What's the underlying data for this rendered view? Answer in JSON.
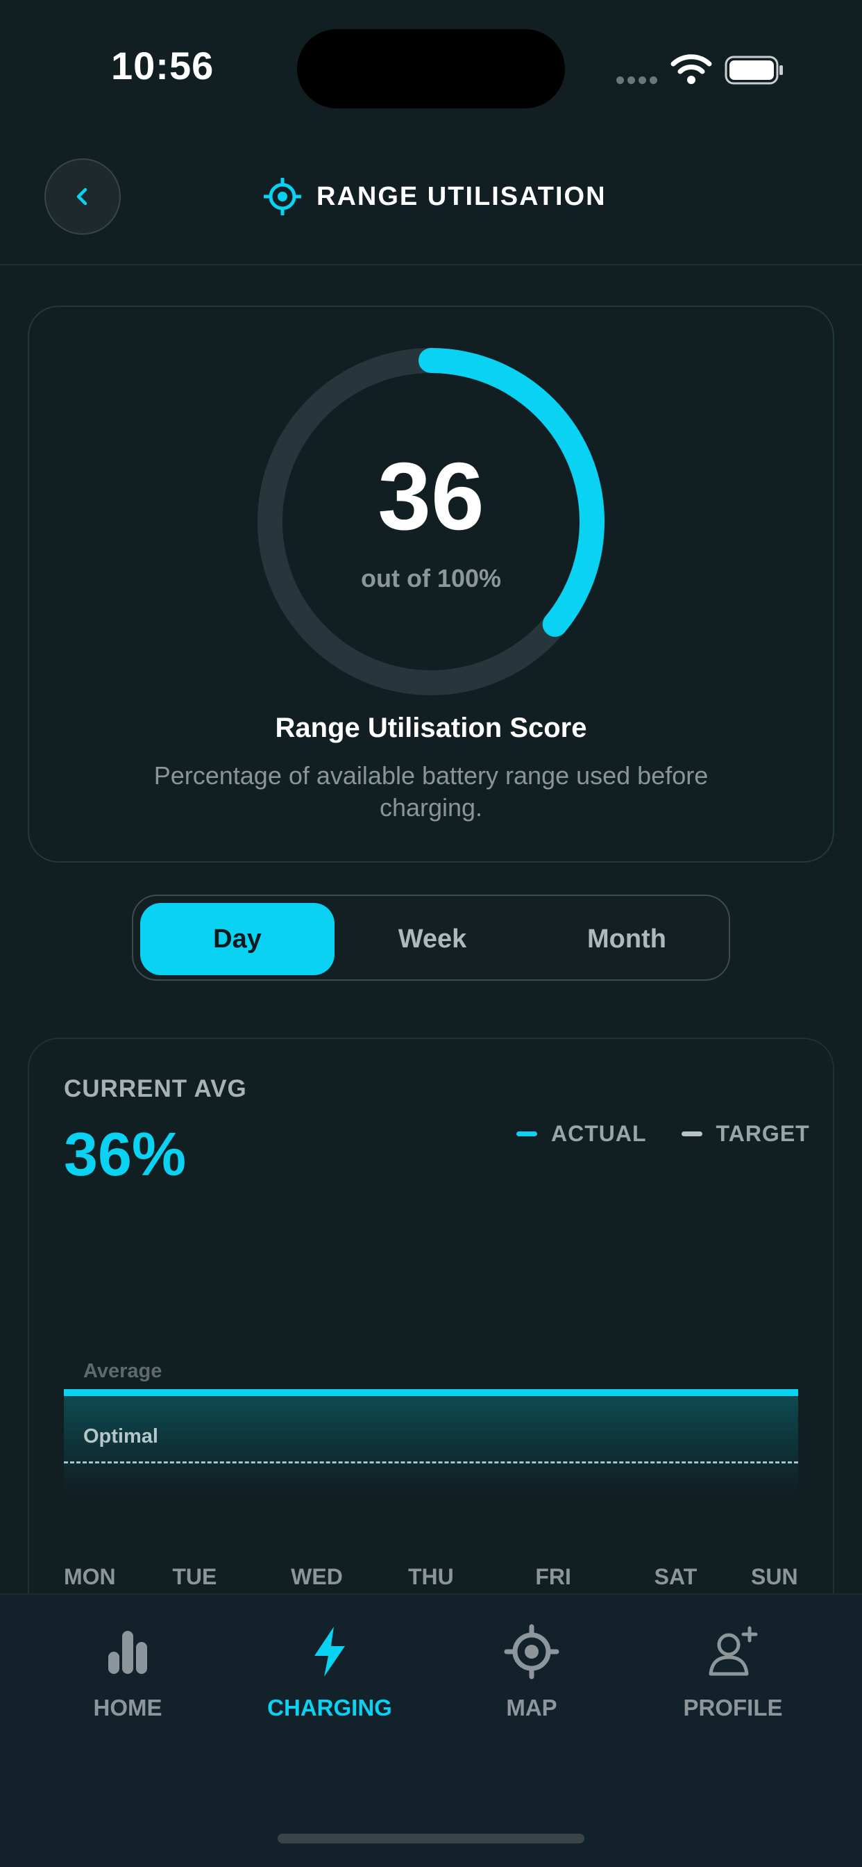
{
  "status_bar": {
    "time": "10:56"
  },
  "header": {
    "title": "RANGE UTILISATION",
    "back_icon": "chevron-left-icon",
    "title_icon": "target-icon"
  },
  "score_card": {
    "score": "36",
    "score_fraction": 0.36,
    "out_of": "out of 100%",
    "title": "Range Utilisation Score",
    "description": "Percentage of available battery range used before charging."
  },
  "period_selector": {
    "options": [
      "Day",
      "Week",
      "Month"
    ],
    "selected": "Day"
  },
  "chart_card": {
    "current_avg_label": "CURRENT AVG",
    "current_avg_value": "36%",
    "legend": [
      {
        "label": "ACTUAL",
        "color": "#0ad2f2"
      },
      {
        "label": "TARGET",
        "color": "#b9c2c5"
      }
    ],
    "average_caption": "Average",
    "optimal_caption": "Optimal"
  },
  "chart_data": {
    "type": "line",
    "categories": [
      "MON",
      "TUE",
      "WED",
      "THU",
      "FRI",
      "SAT",
      "SUN"
    ],
    "series": [
      {
        "name": "ACTUAL",
        "values": [
          36,
          36,
          36,
          36,
          36,
          36,
          36
        ]
      }
    ],
    "annotations": [
      "Average",
      "Optimal"
    ],
    "grid": false,
    "legend_position": "top-right"
  },
  "tab_bar": {
    "tabs": [
      {
        "label": "HOME",
        "icon": "bar-chart-icon"
      },
      {
        "label": "CHARGING",
        "icon": "lightning-icon"
      },
      {
        "label": "MAP",
        "icon": "target-icon"
      },
      {
        "label": "PROFILE",
        "icon": "add-user-icon"
      }
    ],
    "active": "CHARGING"
  },
  "colors": {
    "accent": "#0ad2f2",
    "background": "#111f23"
  }
}
